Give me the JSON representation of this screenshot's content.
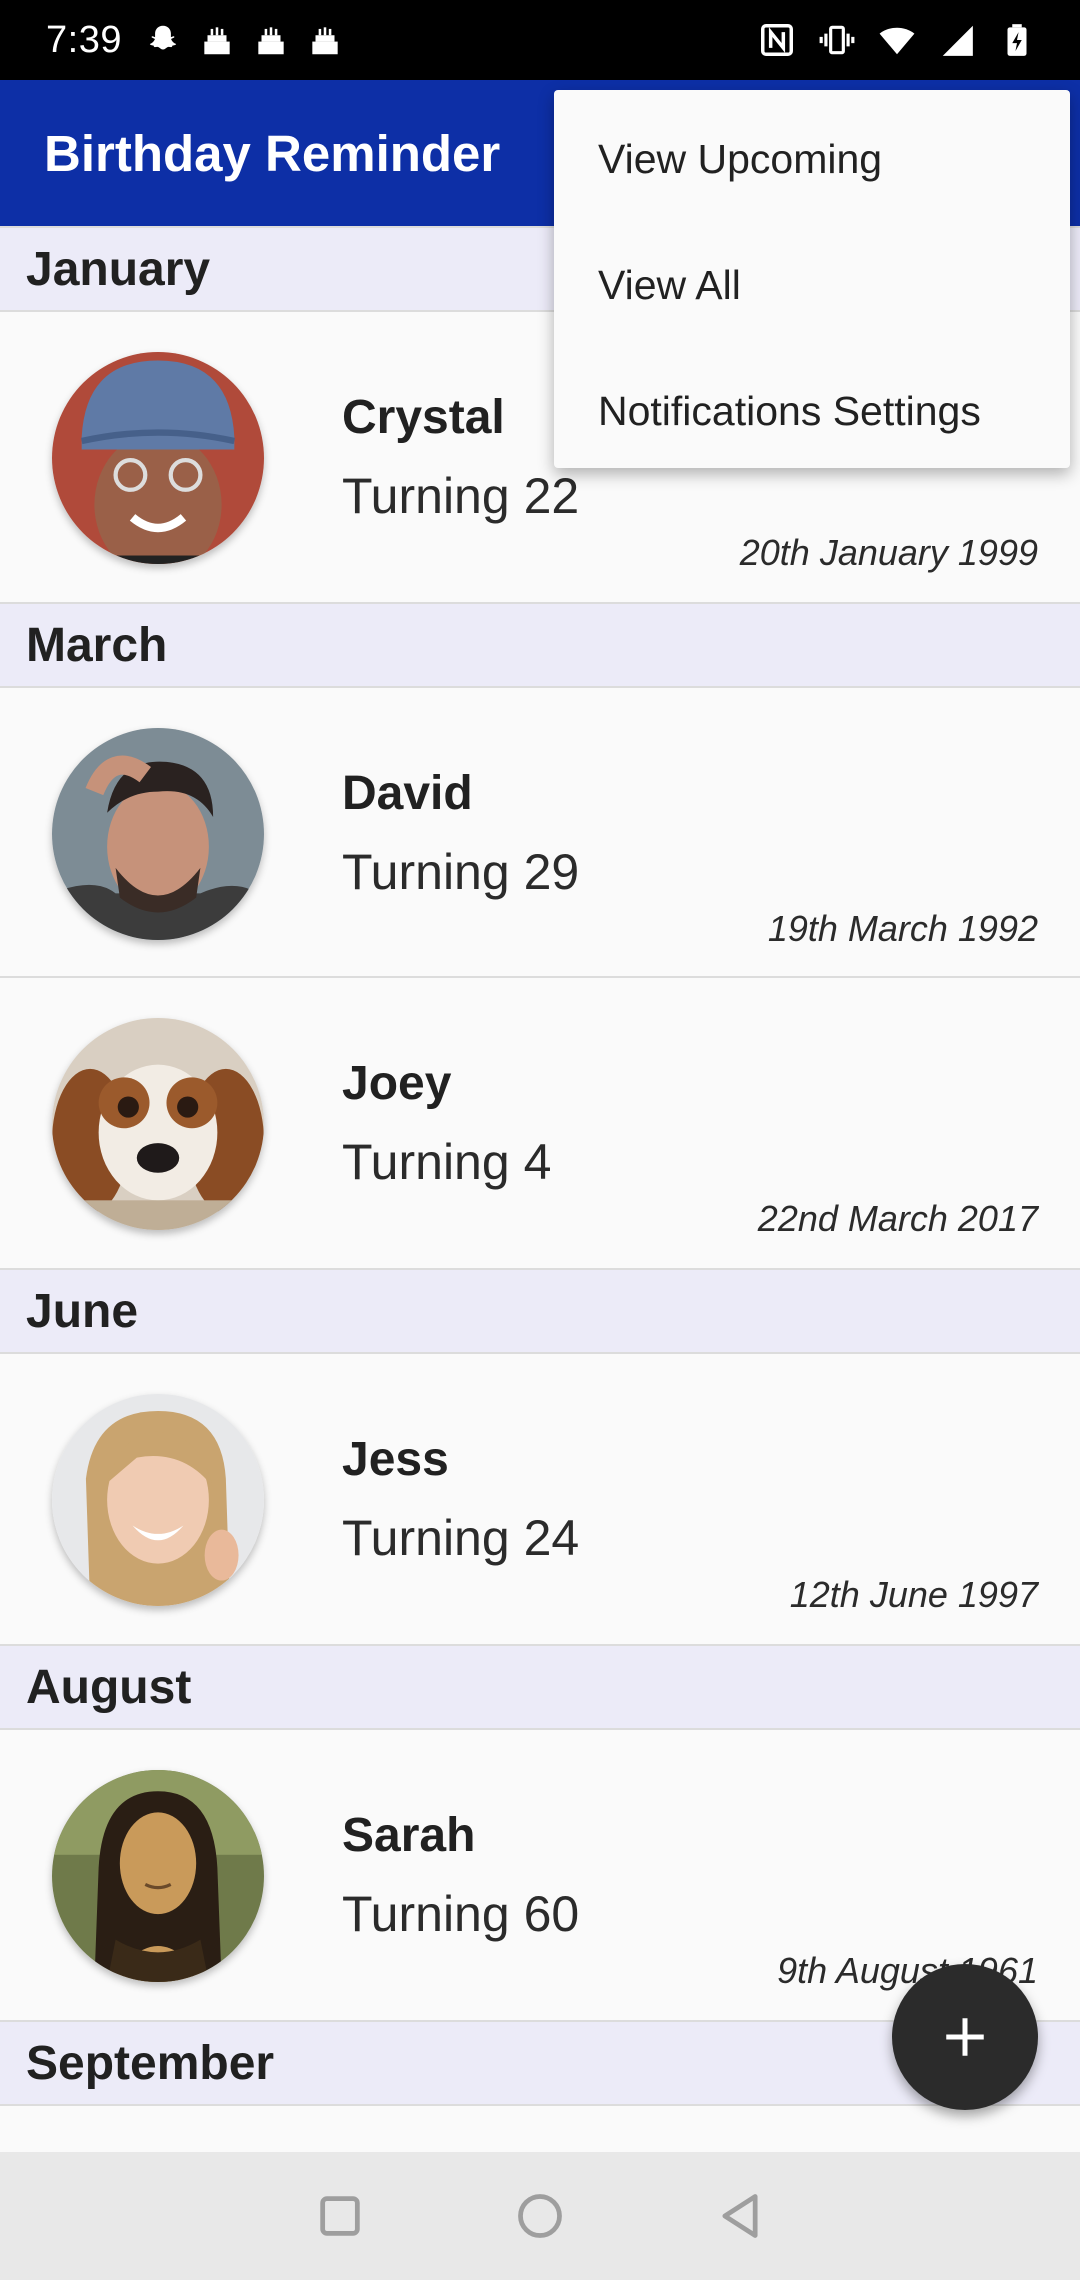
{
  "status_bar": {
    "time": "7:39",
    "left_icons": [
      "snapchat-icon",
      "cake-icon",
      "cake-icon",
      "cake-icon"
    ],
    "right_icons": [
      "nfc-icon",
      "vibrate-icon",
      "wifi-icon",
      "signal-icon",
      "battery-charging-icon"
    ]
  },
  "app_bar": {
    "title": "Birthday Reminder",
    "color": "#0d2fa6"
  },
  "menu": {
    "items": [
      "View Upcoming",
      "View All",
      "Notifications Settings"
    ]
  },
  "months": [
    {
      "name": "January",
      "people": [
        {
          "name": "Crystal",
          "age": "Turning 22",
          "date": "20th January 1999"
        }
      ]
    },
    {
      "name": "March",
      "people": [
        {
          "name": "David",
          "age": "Turning 29",
          "date": "19th March 1992"
        },
        {
          "name": "Joey",
          "age": "Turning 4",
          "date": "22nd March 2017"
        }
      ]
    },
    {
      "name": "June",
      "people": [
        {
          "name": "Jess",
          "age": "Turning 24",
          "date": "12th June 1997"
        }
      ]
    },
    {
      "name": "August",
      "people": [
        {
          "name": "Sarah",
          "age": "Turning 60",
          "date": "9th August 1961"
        }
      ]
    },
    {
      "name": "September",
      "people": []
    }
  ],
  "fab": {
    "icon": "plus-icon"
  },
  "nav_bar": {
    "icons": [
      "recents-square-icon",
      "home-circle-icon",
      "back-triangle-icon"
    ]
  }
}
